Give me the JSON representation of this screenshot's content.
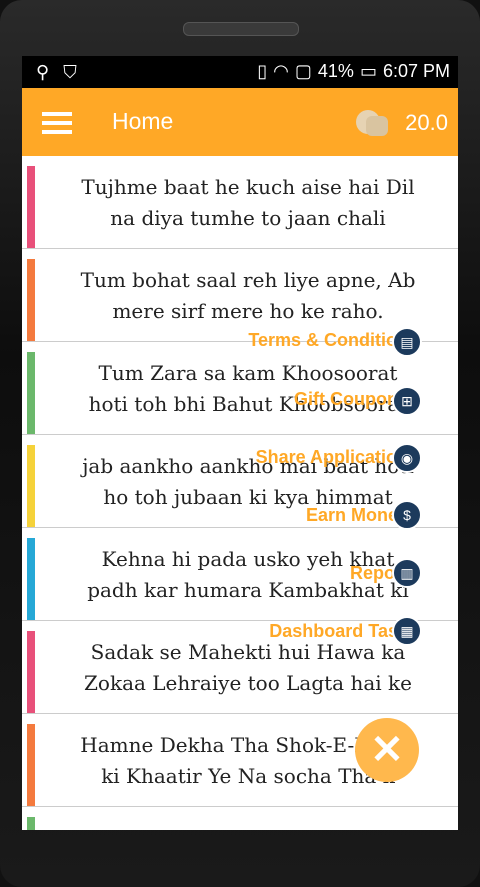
{
  "status": {
    "battery_percent": "41%",
    "time": "6:07 PM"
  },
  "appbar": {
    "title": "Home",
    "coins": "20.0"
  },
  "colors": {
    "accent": "#ffa826",
    "fab_mini": "#1c3a5c"
  },
  "items": [
    {
      "line1": "Tujhme baat he kuch aise hai Dil",
      "line2": "na diya tumhe to jaan chali",
      "color": "#e8507a"
    },
    {
      "line1": "Tum bohat saal reh liye apne, Ab",
      "line2": "mere sirf mere ho ke raho.",
      "color": "#f47a3e"
    },
    {
      "line1": "Tum Zara sa kam Khoosoorat",
      "line2": "hoti toh bhi Bahut Khoobsoorat",
      "color": "#6bb86b"
    },
    {
      "line1": "jab aankho aankho mai baat hoti",
      "line2": "ho toh jubaan ki kya himmat",
      "color": "#f5d23a"
    },
    {
      "line1": "Kehna hi pada usko yeh khat",
      "line2": "padh kar humara Kambakhat ki",
      "color": "#26a8d6"
    },
    {
      "line1": "Sadak se Mahekti hui Hawa ka",
      "line2": "Zokaa Lehraiye too Lagta hai ke",
      "color": "#e8507a"
    },
    {
      "line1": "Hamne Dekha Tha Shok-E-Nazar",
      "line2": "ki Khaatir Ye Na socha Tha k",
      "color": "#f47a3e"
    }
  ],
  "fab_menu": [
    {
      "label": "Terms & Condition",
      "icon": "clipboard-icon"
    },
    {
      "label": "Gift Coupons",
      "icon": "gift-icon"
    },
    {
      "label": "Share Application",
      "icon": "share-icon"
    },
    {
      "label": "Earn Money",
      "icon": "money-bag-icon"
    },
    {
      "label": "Report",
      "icon": "report-icon"
    },
    {
      "label": "Dashboard Task",
      "icon": "dashboard-icon"
    }
  ]
}
